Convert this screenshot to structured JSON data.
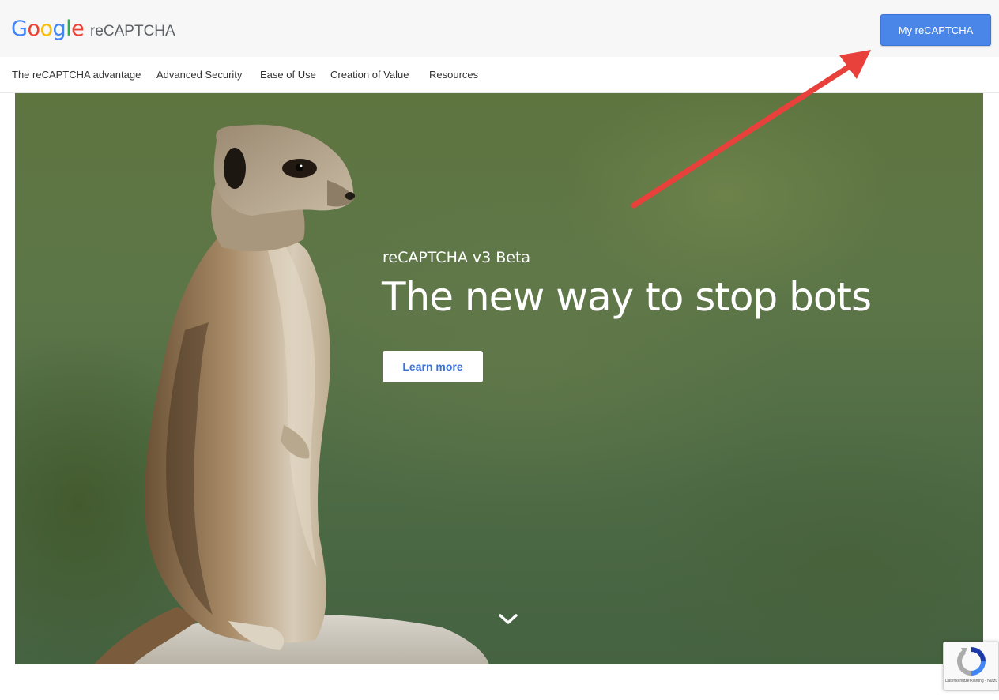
{
  "header": {
    "logo": "Google",
    "product_name": "reCAPTCHA",
    "my_recaptcha_label": "My reCAPTCHA"
  },
  "nav": {
    "items": [
      {
        "label": "The reCAPTCHA advantage"
      },
      {
        "label": "Advanced Security"
      },
      {
        "label": "Ease of Use"
      },
      {
        "label": "Creation of Value"
      },
      {
        "label": "Resources"
      }
    ]
  },
  "hero": {
    "eyebrow": "reCAPTCHA v3 Beta",
    "headline": "The new way to stop bots",
    "cta_label": "Learn more",
    "scroll_icon": "chevron-down-icon"
  },
  "badge": {
    "footer_text": "Datenschutzerklärung - Nutzungsbedingungen"
  },
  "colors": {
    "google_blue": "#4285F4",
    "google_red": "#EA4335",
    "google_yellow": "#FBBC05",
    "google_green": "#34A853",
    "button_blue": "#4a86e8",
    "annotation_arrow": "#e8413c"
  }
}
